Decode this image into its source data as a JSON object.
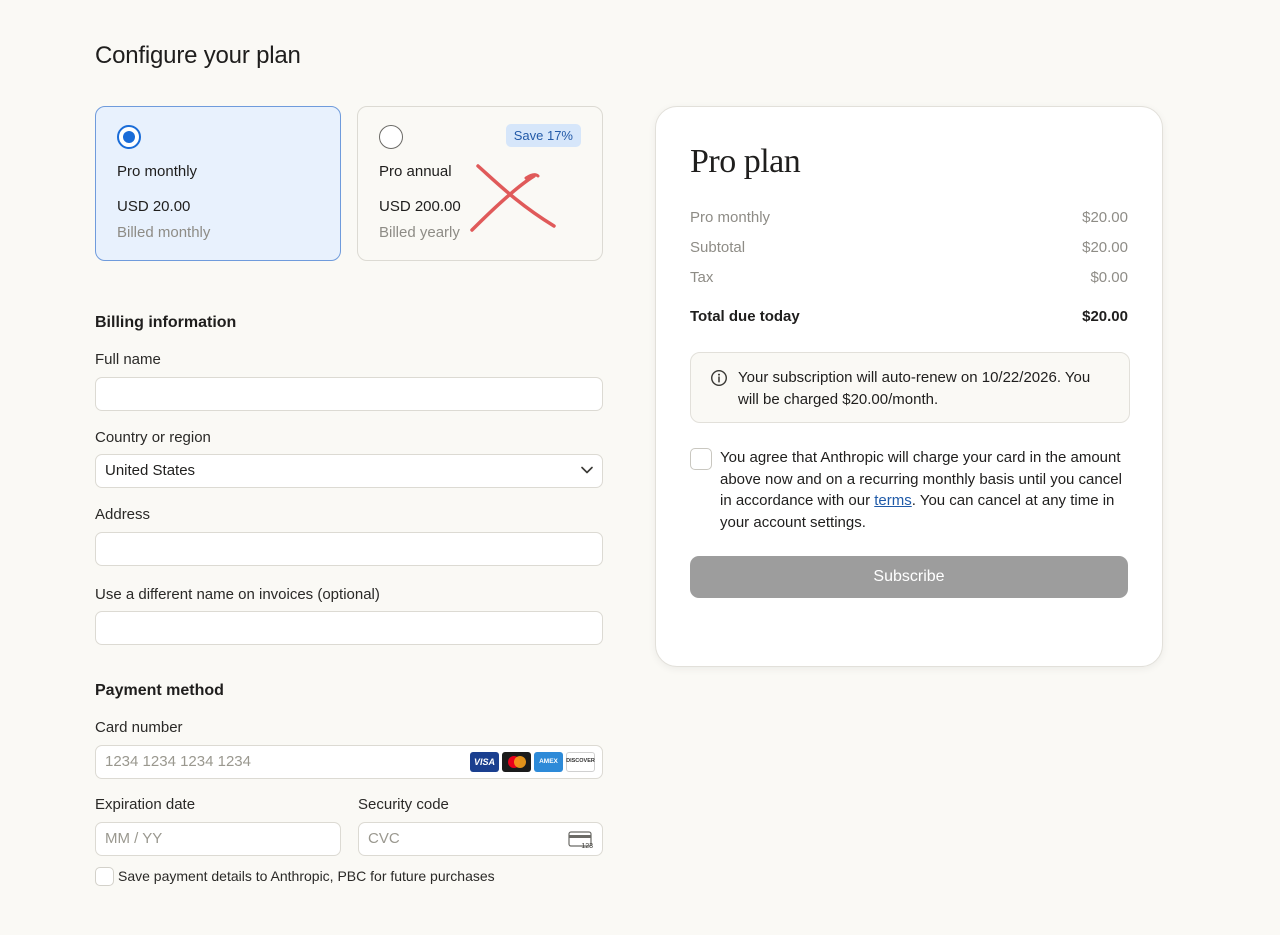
{
  "page": {
    "title": "Configure your plan"
  },
  "plans": {
    "monthly": {
      "name": "Pro monthly",
      "price": "USD 20.00",
      "billing": "Billed monthly",
      "selected": true
    },
    "annual": {
      "name": "Pro annual",
      "price": "USD 200.00",
      "billing": "Billed yearly",
      "badge": "Save 17%",
      "selected": false
    }
  },
  "billing": {
    "heading": "Billing information",
    "full_name_label": "Full name",
    "full_name_value": "",
    "country_label": "Country or region",
    "country_value": "United States",
    "address_label": "Address",
    "address_value": "",
    "invoice_name_label": "Use a different name on invoices (optional)",
    "invoice_name_value": ""
  },
  "payment": {
    "heading": "Payment method",
    "card_label": "Card number",
    "card_placeholder": "1234 1234 1234 1234",
    "card_brands": [
      "VISA",
      "Mastercard",
      "AMEX",
      "DISCOVER"
    ],
    "expiry_label": "Expiration date",
    "expiry_placeholder": "MM / YY",
    "cvc_label": "Security code",
    "cvc_placeholder": "CVC",
    "save_details_label": "Save payment details to Anthropic, PBC for future purchases",
    "save_details_checked": false
  },
  "summary": {
    "title": "Pro plan",
    "lines": [
      {
        "label": "Pro monthly",
        "amount": "$20.00"
      },
      {
        "label": "Subtotal",
        "amount": "$20.00"
      },
      {
        "label": "Tax",
        "amount": "$0.00"
      }
    ],
    "total": {
      "label": "Total due today",
      "amount": "$20.00"
    },
    "notice": "Your subscription will auto-renew on 10/22/2026. You will be charged $20.00/month.",
    "agree_before": "You agree that Anthropic will charge your card in the amount above now and on a recurring monthly basis until you cancel in accordance with our ",
    "agree_link": "terms",
    "agree_after": ". You can cancel at any time in your account settings.",
    "agree_checked": false,
    "subscribe_label": "Subscribe"
  },
  "colors": {
    "accent": "#1a6cd8",
    "selected_card_bg": "#e8f1fd",
    "button_disabled": "#9d9d9d",
    "annotation_mark": "#e05a5a"
  }
}
